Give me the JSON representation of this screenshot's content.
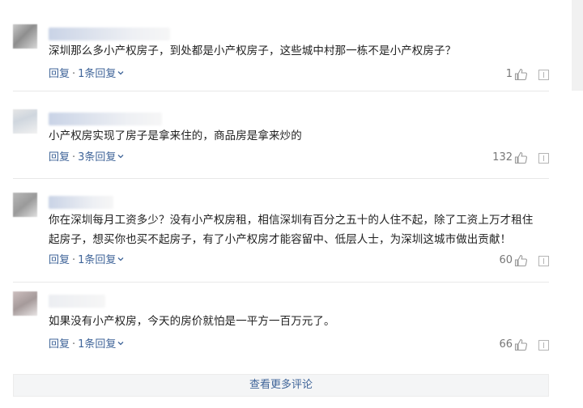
{
  "comments": [
    {
      "text": "深圳那么多小产权房子，到处都是小产权房子，这些城中村那一栋不是小产权房子？",
      "reply_label": "回复",
      "replies_label": "1条回复",
      "likes": "1"
    },
    {
      "text": "小产权房实现了房子是拿来住的，商品房是拿来炒的",
      "reply_label": "回复",
      "replies_label": "3条回复",
      "likes": "132"
    },
    {
      "text": "你在深圳每月工资多少？没有小产权房租，相信深圳有百分之五十的人住不起，除了工资上万才租住\n起房子，想买你也买不起房子，有了小产权房才能容留中、低层人士，为深圳这城市做出贡献！",
      "reply_label": "回复",
      "replies_label": "1条回复",
      "likes": "60"
    },
    {
      "text": "如果没有小产权房，今天的房价就怕是一平方一百万元了。",
      "reply_label": "回复",
      "replies_label": "1条回复",
      "likes": "66"
    }
  ],
  "load_more_label": "查看更多评论",
  "colors": {
    "link": "#406599",
    "text": "#222222",
    "muted": "#777777",
    "divider": "#e8e8e8"
  },
  "icons": [
    "thumbs-up-icon",
    "report-icon",
    "chevron-down-icon"
  ]
}
